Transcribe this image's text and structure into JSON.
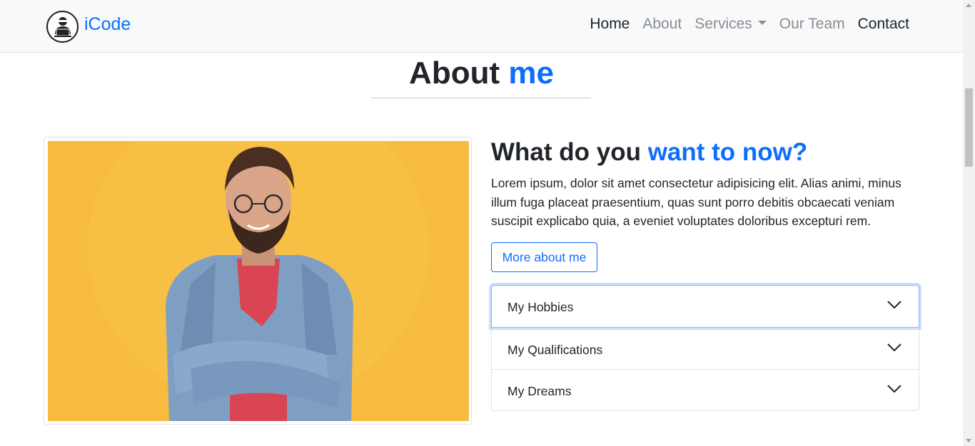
{
  "navbar": {
    "brand": "iCode",
    "links": [
      {
        "label": "Home"
      },
      {
        "label": "About"
      },
      {
        "label": "Services"
      },
      {
        "label": "Our Team"
      },
      {
        "label": "Contact"
      }
    ]
  },
  "about": {
    "title_main": "About",
    "title_accent": "me"
  },
  "content": {
    "heading_main": "What do you",
    "heading_accent": "want to now?",
    "paragraph": "Lorem ipsum, dolor sit amet consectetur adipisicing elit. Alias animi, minus illum fuga placeat praesentium, quas sunt porro debitis obcaecati veniam suscipit explicabo quia, a eveniet voluptates doloribus excepturi rem.",
    "button": "More about me"
  },
  "accordion": {
    "items": [
      {
        "label": "My Hobbies"
      },
      {
        "label": "My Qualifications"
      },
      {
        "label": "My Dreams"
      }
    ]
  },
  "colors": {
    "accent": "#0d6efd",
    "photo_background": "#f6bb3f",
    "navbar_background": "#f8f9fa"
  }
}
